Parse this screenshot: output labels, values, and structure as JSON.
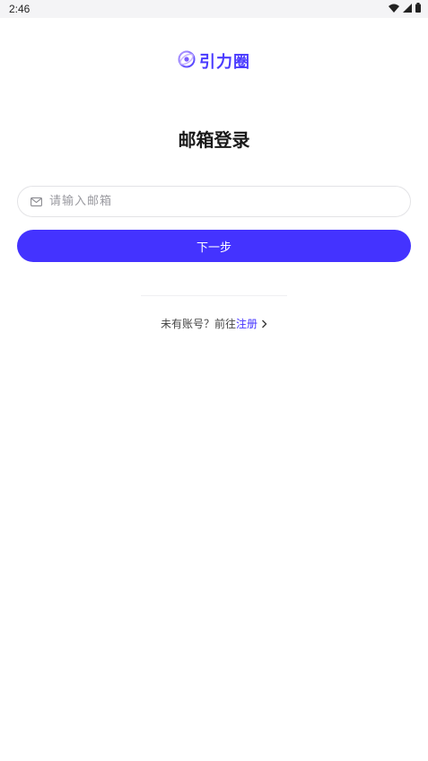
{
  "status_bar": {
    "time": "2:46"
  },
  "logo": {
    "text": "引力圈",
    "color": "#4a3bff"
  },
  "title": "邮箱登录",
  "email": {
    "value": "",
    "placeholder": "请输入邮箱"
  },
  "next_button": {
    "label": "下一步",
    "color": "#4433ff"
  },
  "register": {
    "prompt": "未有账号？前往",
    "link": "注册"
  },
  "icons": {
    "status": [
      "wifi-icon",
      "signal-icon",
      "battery-icon"
    ],
    "logo": "orbit-logo-icon",
    "email": "mail-icon",
    "register": "chevron-right-icon"
  }
}
